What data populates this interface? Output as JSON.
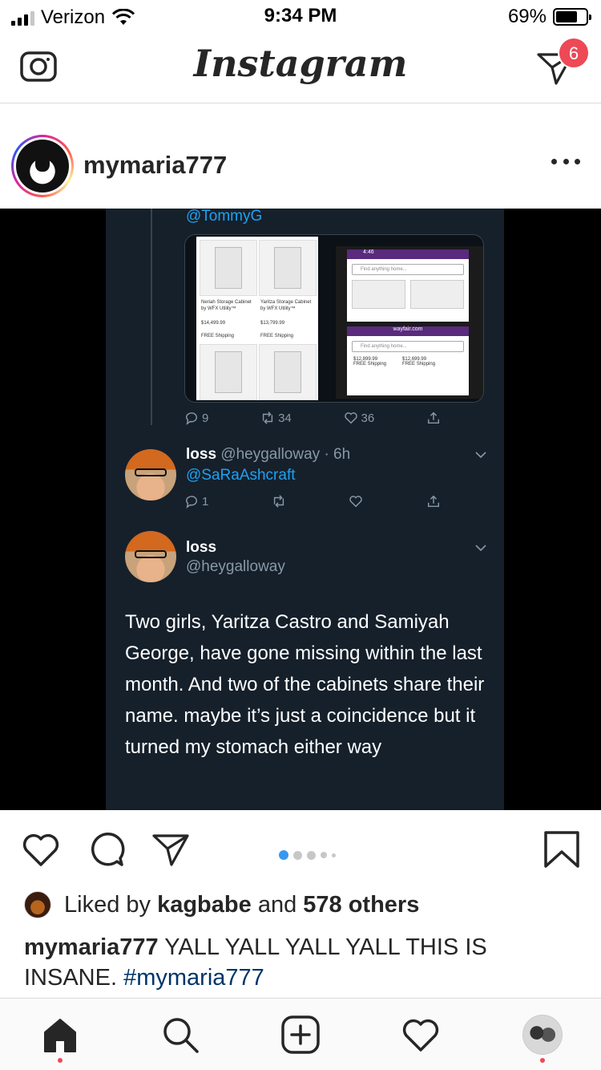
{
  "status_bar": {
    "carrier": "Verizon",
    "time": "9:34 PM",
    "battery_percent": "69%"
  },
  "header": {
    "logo": "Instagram",
    "dm_badge_count": "6"
  },
  "post": {
    "username": "mymaria777",
    "image": {
      "tweet_top_mention": "@TommyG",
      "first_tweet_actions": {
        "replies": "9",
        "retweets": "34",
        "likes": "36"
      },
      "reply": {
        "name": "loss",
        "handle_time": "@heygalloway · 6h",
        "mention": "@SaRaAshcraft",
        "replies": "1"
      },
      "main_tweet": {
        "name": "loss",
        "handle": "@heygalloway",
        "body": "Two girls, Yaritza Castro and Samiyah George, have gone missing within the last month. And two of the cabinets share their name. maybe it’s just a coincidence but it turned my stomach either way"
      },
      "products": [
        {
          "name": "Neriah Storage Cabinet by WFX Utility™",
          "price": "$14,499.99",
          "shipping": "FREE Shipping"
        },
        {
          "name": "Yaritza Storage Cabinet by WFX Utility™",
          "price": "$13,799.99",
          "shipping": "FREE Shipping"
        },
        {
          "price": "$12,899.99",
          "shipping": "FREE Shipping"
        },
        {
          "price": "$12,699.99",
          "shipping": "FREE Shipping"
        }
      ],
      "phone_time": "4:46",
      "phone_url": "wayfair.com",
      "search_placeholder": "Find anything home..."
    },
    "carousel": {
      "active_index": 0,
      "count": 5
    },
    "liked_by": {
      "prefix": "Liked by",
      "user": "kagbabe",
      "joiner": "and",
      "others": "578 others"
    },
    "caption": {
      "username": "mymaria777",
      "text": "YALL YALL YALL YALL THIS IS INSANE.",
      "hashtag": "#mymaria777"
    }
  },
  "bottom_nav": {
    "items": [
      "home-icon",
      "search-icon",
      "add-post-icon",
      "activity-heart-icon",
      "profile-avatar"
    ]
  },
  "colors": {
    "badge": "#ed4956",
    "tweet_bg": "#15202b",
    "twitter_blue": "#1da1f2",
    "carousel_active": "#3897f0",
    "hashtag": "#003569"
  }
}
